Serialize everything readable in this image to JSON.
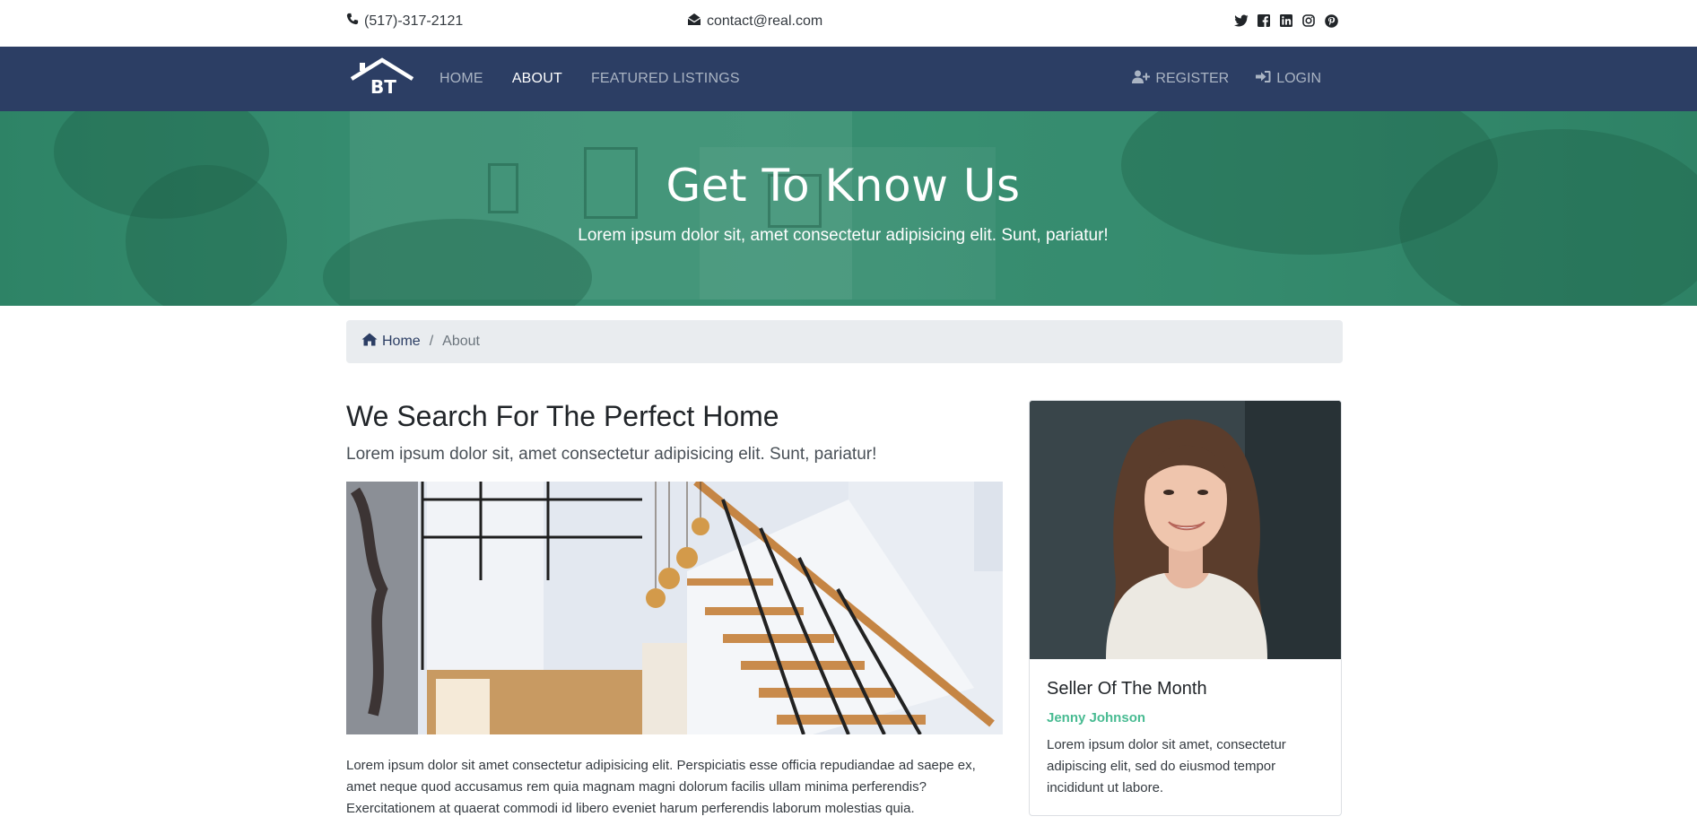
{
  "topbar": {
    "phone": "(517)-317-2121",
    "email": "contact@real.com",
    "social_icons": [
      "twitter-icon",
      "facebook-icon",
      "linkedin-icon",
      "instagram-icon",
      "pinterest-icon"
    ]
  },
  "navbar": {
    "logo_text": "BT",
    "links": [
      {
        "label": "HOME",
        "active": false
      },
      {
        "label": "ABOUT",
        "active": true
      },
      {
        "label": "FEATURED LISTINGS",
        "active": false
      }
    ],
    "register_label": "REGISTER",
    "login_label": "LOGIN"
  },
  "hero": {
    "title": "Get To Know Us",
    "subtitle": "Lorem ipsum dolor sit, amet consectetur adipisicing elit. Sunt, pariatur!"
  },
  "breadcrumb": {
    "home_label": "Home",
    "separator": "/",
    "current": "About"
  },
  "main": {
    "title": "We Search For The Perfect Home",
    "subtitle": "Lorem ipsum dolor sit, amet consectetur adipisicing elit. Sunt, pariatur!",
    "body": "Lorem ipsum dolor sit amet consectetur adipisicing elit. Perspiciatis esse officia repudiandae ad saepe ex, amet neque quod accusamus rem quia magnam magni dolorum facilis ullam minima perferendis? Exercitationem at quaerat commodi id libero eveniet harum perferendis laborum molestias quia."
  },
  "card": {
    "title": "Seller Of The Month",
    "name": "Jenny Johnson",
    "description": "Lorem ipsum dolor sit amet, consectetur adipiscing elit, sed do eiusmod tempor incididunt ut labore."
  },
  "colors": {
    "navbar": "#2c3e64",
    "hero_overlay": "#3a8c70",
    "accent_green": "#48bb92",
    "breadcrumb_bg": "#e9ecef"
  }
}
